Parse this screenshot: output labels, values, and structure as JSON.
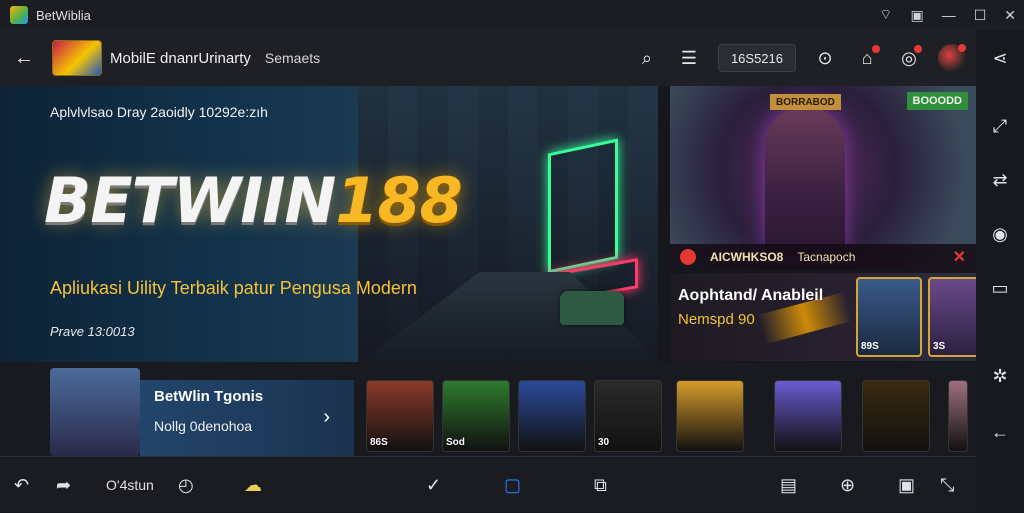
{
  "window": {
    "title": "BetWiblia"
  },
  "appbar": {
    "title": "MobilE dnanrUrinarty",
    "subtitle": "Semaets",
    "code": "16S5216",
    "icons": [
      "back-icon",
      "search-icon",
      "menu-icon",
      "zoom-icon",
      "store-icon",
      "gamepad-icon",
      "avatar"
    ]
  },
  "hero": {
    "top_text": "Aplvlvlsao Dray 2aoidly 10292e:zıh",
    "brand_a": "BETWIIN",
    "brand_b": "188",
    "tagline": "Apliukasi Uility Terbaik patur Pengusa Modern",
    "price": "Prave 13:0013"
  },
  "promo1": {
    "badge_top": "BORRABOD",
    "badge_corner": "BOOODD",
    "strip_label": "AICWHKSO8",
    "strip_sub": "Tacnapoch"
  },
  "promo2": {
    "title": "Aophtand/ Anableil",
    "sub": "Nemspd 90",
    "card1": "89S",
    "card2": "3S"
  },
  "featured": {
    "title": "BetWlin Tgonis",
    "sub": "Nollg 0denohoa"
  },
  "thumbs": [
    {
      "label": "86S",
      "bg": "#8a3a2a"
    },
    {
      "label": "Sod",
      "bg": "#2e7a2e"
    },
    {
      "label": "",
      "bg": "#2a4a9a"
    },
    {
      "label": "30",
      "bg": "#2a2a2a"
    },
    {
      "label": "",
      "bg": "#d59a2a"
    },
    {
      "label": "",
      "bg": "#6a5ad0"
    },
    {
      "label": "",
      "bg": "#3a2a10"
    },
    {
      "label": "",
      "bg": "#a07080"
    }
  ],
  "navbar": {
    "label": "O'4stun"
  }
}
